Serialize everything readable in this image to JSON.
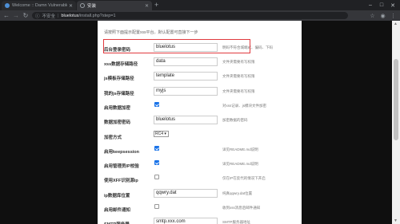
{
  "tabs": [
    {
      "title": "Welcome :: Damn Vulnerable",
      "icon_color": "#4d8fd6"
    },
    {
      "title": "安装",
      "icon_color": "#9aa0a6"
    }
  ],
  "omnibox": {
    "security_label": "不安全",
    "url_host": "bluelotus",
    "url_path": "/install.php?step=1"
  },
  "page": {
    "intro": "请按照下面提示配置xss平台。默认配置可直接下一步",
    "rows": [
      {
        "label": "后台登录密码",
        "type": "input",
        "value": "bluelotus",
        "hint": "明码不符合城端式、偏码、下码"
      },
      {
        "label": "xss数据存储路径",
        "type": "input",
        "value": "data",
        "hint": "文件夹需要有写权限"
      },
      {
        "label": "js模板存储路径",
        "type": "input",
        "value": "template",
        "hint": "文件夹需要有写权限"
      },
      {
        "label": "我的js存储路径",
        "type": "input",
        "value": "myjs",
        "hint": "文件夹需要有写权限"
      },
      {
        "label": "启用数据加密",
        "type": "checkbox",
        "checked": true,
        "hint": "对xss记录、js模块文件加密"
      },
      {
        "label": "数据加密密码",
        "type": "input",
        "value": "bluelotus",
        "hint": "加密数据的密码"
      },
      {
        "label": "加密方式",
        "type": "select",
        "value": "RC4",
        "hint": ""
      },
      {
        "label": "启用keepsession",
        "type": "checkbox",
        "checked": true,
        "hint": "详见README.md说明"
      },
      {
        "label": "启用管理员IP校验",
        "type": "checkbox",
        "checked": true,
        "hint": "详见README.md说明"
      },
      {
        "label": "使用XFF识别源ip",
        "type": "checkbox",
        "checked": false,
        "hint": "仅在IP在反代的情况下开启"
      },
      {
        "label": "ip数据库位置",
        "type": "input",
        "value": "qqwry.dat",
        "hint": "纯真qqwry.dat位置"
      },
      {
        "label": "启用邮件通知",
        "type": "checkbox",
        "checked": false,
        "hint": "收到xss消息后邮件通知"
      },
      {
        "label": "SMTP服务器",
        "type": "input",
        "value": "smtp.xxx.com",
        "hint": "SMTP服务器地址"
      }
    ]
  },
  "colors": {
    "highlight": "#e0393e",
    "checkbox_on": "#1a73e8"
  }
}
